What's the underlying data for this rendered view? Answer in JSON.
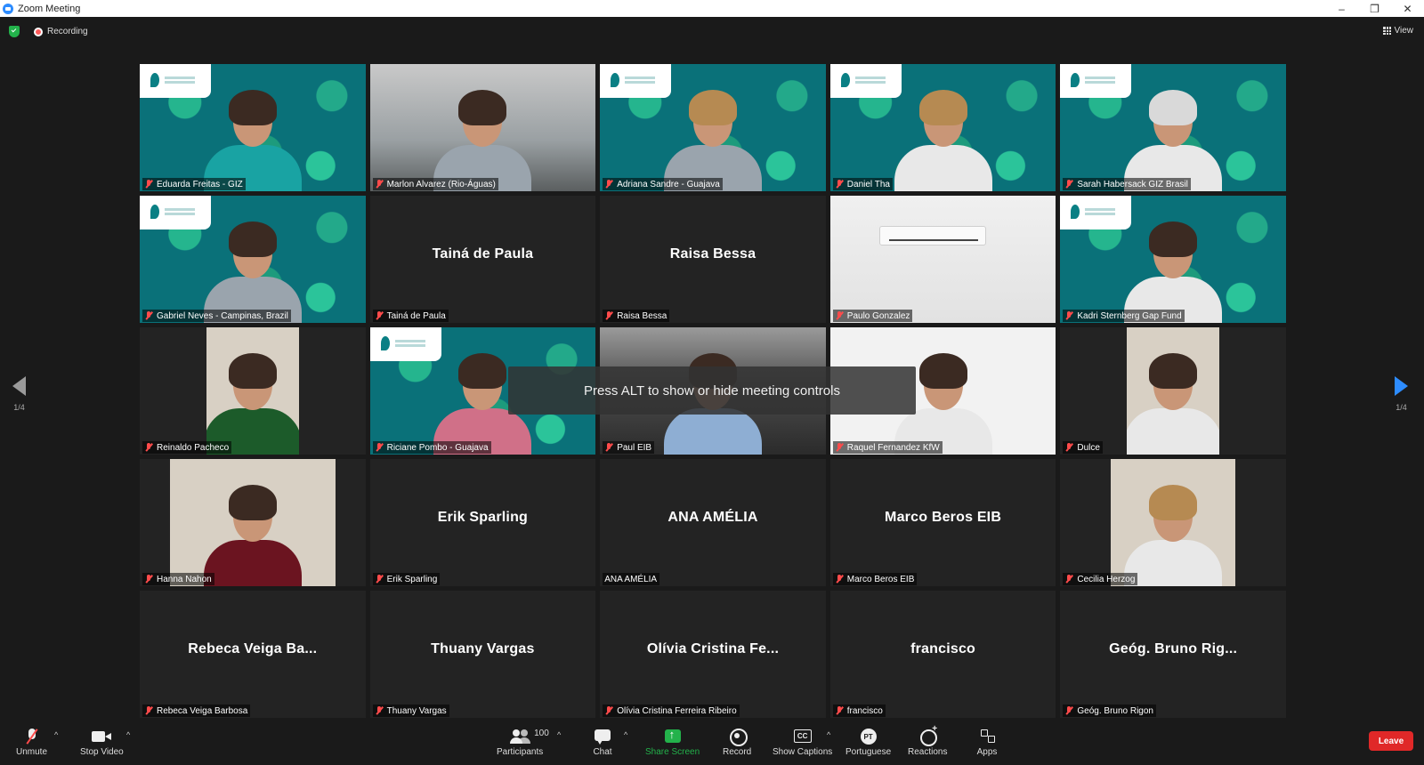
{
  "window": {
    "title": "Zoom Meeting",
    "controls": [
      "–",
      "❐",
      "✕"
    ]
  },
  "topbar": {
    "recording": "Recording",
    "view": "View"
  },
  "pager": {
    "left": "1/4",
    "right": "1/4"
  },
  "tooltip": "Press ALT to show or hide meeting controls",
  "tiles": [
    {
      "name": "Eduarda Freitas - GIZ",
      "kind": "bg"
    },
    {
      "name": "Marlon Alvarez (Rio-Águas)",
      "kind": "office"
    },
    {
      "name": "Adriana Sandre - Guajava",
      "kind": "bg"
    },
    {
      "name": "Daniel Tha",
      "kind": "bg"
    },
    {
      "name": "Sarah Habersack GIZ Brasil",
      "kind": "bg",
      "active": true
    },
    {
      "name": "Gabriel Neves - Campinas, Brazil",
      "kind": "bg"
    },
    {
      "name": "Tainá de Paula",
      "display": "Tainá de Paula",
      "kind": "name"
    },
    {
      "name": "Raisa Bessa",
      "display": "Raisa Bessa",
      "kind": "name"
    },
    {
      "name": "Paulo Gonzalez",
      "kind": "ac"
    },
    {
      "name": "Kadri Sternberg Gap Fund",
      "kind": "bg"
    },
    {
      "name": "Reinaldo Pacheco",
      "kind": "portrait"
    },
    {
      "name": "Riciane Pombo - Guajava",
      "kind": "bg"
    },
    {
      "name": "Paul EIB",
      "kind": "blur"
    },
    {
      "name": "Raquel Fernandez KfW",
      "kind": "white"
    },
    {
      "name": "Dulce",
      "kind": "portrait"
    },
    {
      "name": "Hanna Nahon",
      "kind": "portrait"
    },
    {
      "name": "Erik Sparling",
      "display": "Erik Sparling",
      "kind": "name"
    },
    {
      "name": "ANA AMÉLIA",
      "display": "ANA AMÉLIA",
      "kind": "name",
      "unmuted": true
    },
    {
      "name": "Marco Beros EIB",
      "display": "Marco Beros EIB",
      "kind": "name"
    },
    {
      "name": "Cecilia Herzog",
      "kind": "portrait"
    },
    {
      "name": "Rebeca Veiga Barbosa",
      "display": "Rebeca Veiga Ba...",
      "kind": "name"
    },
    {
      "name": "Thuany Vargas",
      "display": "Thuany Vargas",
      "kind": "name"
    },
    {
      "name": "Olívia Cristina Ferreira Ribeiro",
      "display": "Olívia Cristina Fe...",
      "kind": "name"
    },
    {
      "name": "francisco",
      "display": "francisco",
      "kind": "name"
    },
    {
      "name": "Geóg. Bruno Rigon",
      "display": "Geóg. Bruno Rig...",
      "kind": "name"
    }
  ],
  "toolbar": {
    "unmute": "Unmute",
    "stop_video": "Stop Video",
    "participants": "Participants",
    "participants_count": "100",
    "chat": "Chat",
    "share_screen": "Share Screen",
    "record": "Record",
    "show_captions": "Show Captions",
    "captions_icon": "CC",
    "language": "Portuguese",
    "language_icon": "PT",
    "reactions": "Reactions",
    "apps": "Apps",
    "leave": "Leave"
  },
  "colors": {
    "accent": "#2D8CFF",
    "share": "#23b24b",
    "leave": "#e02828",
    "active_speaker": "#d8e84a"
  }
}
